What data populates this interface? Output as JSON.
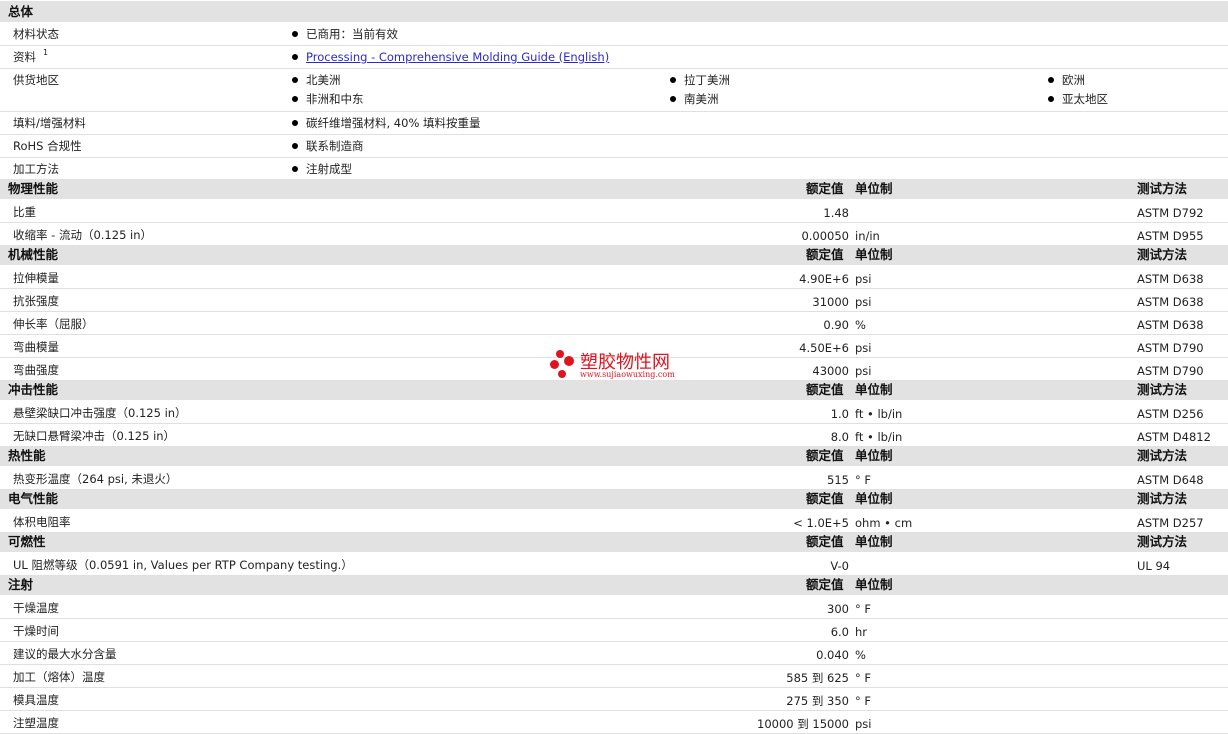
{
  "general": {
    "title": "总体",
    "rows": [
      {
        "label": "材料状态",
        "values": [
          "已商用：当前有效"
        ]
      },
      {
        "label": "资料",
        "sup": "1",
        "values": [
          "Processing - Comprehensive Molding Guide (English)"
        ]
      },
      {
        "label": "供货地区",
        "values": [
          "北美洲",
          "拉丁美洲",
          "欧洲",
          "非洲和中东",
          "南美洲",
          "亚太地区"
        ]
      },
      {
        "label": "填料/增强材料",
        "values": [
          "碳纤维增强材料, 40% 填料按重量"
        ]
      },
      {
        "label": "RoHS 合规性",
        "values": [
          "联系制造商"
        ]
      },
      {
        "label": "加工方法",
        "values": [
          "注射成型"
        ]
      }
    ]
  },
  "headers": {
    "nominal": "额定值",
    "unit": "单位制",
    "method": "测试方法"
  },
  "sections": [
    {
      "title": "物理性能",
      "has_method": true,
      "rows": [
        {
          "label": "比重",
          "value": "1.48",
          "unit": "",
          "method": "ASTM D792"
        },
        {
          "label": "收缩率 - 流动（0.125 in）",
          "value": "0.00050",
          "unit": "in/in",
          "method": "ASTM D955"
        }
      ]
    },
    {
      "title": "机械性能",
      "has_method": true,
      "rows": [
        {
          "label": "拉伸模量",
          "value": "4.90E+6",
          "unit": "psi",
          "method": "ASTM D638"
        },
        {
          "label": "抗张强度",
          "value": "31000",
          "unit": "psi",
          "method": "ASTM D638"
        },
        {
          "label": "伸长率（屈服）",
          "value": "0.90",
          "unit": "%",
          "method": "ASTM D638"
        },
        {
          "label": "弯曲模量",
          "value": "4.50E+6",
          "unit": "psi",
          "method": "ASTM D790"
        },
        {
          "label": "弯曲强度",
          "value": "43000",
          "unit": "psi",
          "method": "ASTM D790"
        }
      ]
    },
    {
      "title": "冲击性能",
      "has_method": true,
      "rows": [
        {
          "label": "悬壁梁缺口冲击强度（0.125 in）",
          "value": "1.0",
          "unit": "ft • lb/in",
          "method": "ASTM D256"
        },
        {
          "label": "无缺口悬臂梁冲击（0.125 in）",
          "value": "8.0",
          "unit": "ft • lb/in",
          "method": "ASTM D4812"
        }
      ]
    },
    {
      "title": "热性能",
      "has_method": true,
      "rows": [
        {
          "label": "热变形温度（264 psi, 未退火）",
          "value": "515",
          "unit": "° F",
          "method": "ASTM D648"
        }
      ]
    },
    {
      "title": "电气性能",
      "has_method": true,
      "rows": [
        {
          "label": "体积电阻率",
          "value": "< 1.0E+5",
          "unit": "ohm • cm",
          "method": "ASTM D257"
        }
      ]
    },
    {
      "title": "可燃性",
      "has_method": true,
      "rows": [
        {
          "label": "UL 阻燃等级（0.0591 in, Values per RTP Company testing.）",
          "value": "V-0",
          "unit": "",
          "method": "UL 94"
        }
      ]
    },
    {
      "title": "注射",
      "has_method": false,
      "rows": [
        {
          "label": "干燥温度",
          "value": "300",
          "unit": "° F",
          "method": ""
        },
        {
          "label": "干燥时间",
          "value": "6.0",
          "unit": "hr",
          "method": ""
        },
        {
          "label": "建议的最大水分含量",
          "value": "0.040",
          "unit": "%",
          "method": ""
        },
        {
          "label": "加工（熔体）温度",
          "value": "585 到  625",
          "unit": "° F",
          "method": ""
        },
        {
          "label": "模具温度",
          "value": "275 到  350",
          "unit": "° F",
          "method": ""
        },
        {
          "label": "注塑温度",
          "value": "10000 到  15000",
          "unit": "psi",
          "method": ""
        }
      ]
    }
  ],
  "watermark": {
    "text": "塑胶物性网",
    "url": "www.sujiaowuxing.com",
    "color": "#e0141e"
  }
}
